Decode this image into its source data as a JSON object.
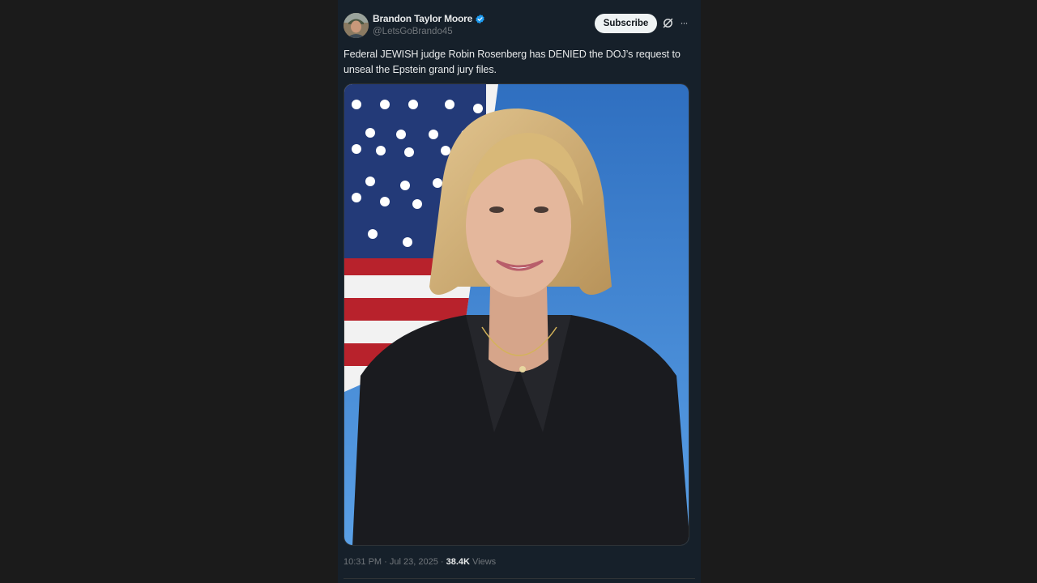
{
  "post": {
    "author": {
      "display_name": "Brandon Taylor Moore",
      "handle": "@LetsGoBrando45",
      "verified": true
    },
    "actions": {
      "subscribe_label": "Subscribe",
      "grok_icon": "grok-icon",
      "more_icon": "more-horizontal-icon",
      "more_glyph": "···"
    },
    "text": "Federal JEWISH judge Robin Rosenberg has DENIED the DOJ’s request to unseal the Epstein grand jury files.",
    "media": {
      "type": "photo"
    },
    "meta": {
      "time": "10:31 PM",
      "separator": " · ",
      "date": "Jul 23, 2025",
      "views_count": "38.4K",
      "views_label": " Views"
    }
  },
  "colors": {
    "page_bg": "#1b1b1b",
    "post_bg": "#16202a",
    "text_primary": "#e7e9ea",
    "text_secondary": "#71767b",
    "verified_blue": "#1d9bf0",
    "subscribe_bg": "#eff3f4"
  }
}
